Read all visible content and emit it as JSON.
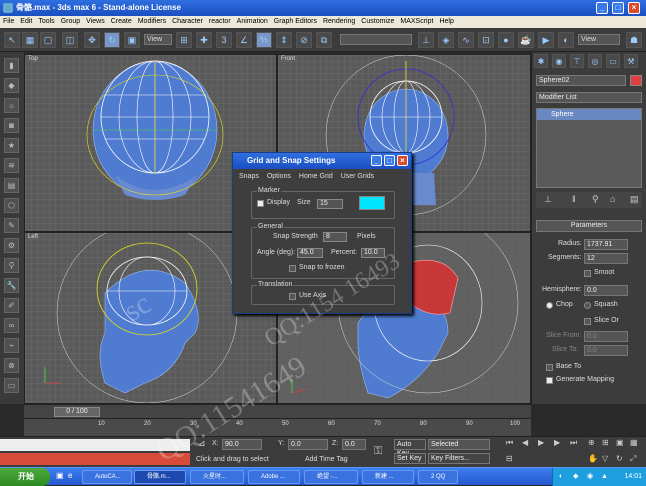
{
  "window": {
    "title": "骨骼.max - 3ds max 6 - Stand-alone License"
  },
  "menu": [
    "File",
    "Edit",
    "Tools",
    "Group",
    "Views",
    "Create",
    "Modifiers",
    "Character",
    "reactor",
    "Animation",
    "Graph Editors",
    "Rendering",
    "Customize",
    "MAXScript",
    "Help"
  ],
  "toolbar": {
    "view_dropdown": "View",
    "view_dropdown2": "View"
  },
  "viewports": {
    "top": "Top",
    "front": "Front",
    "left": "Left",
    "persp": ""
  },
  "dialog": {
    "title": "Grid and Snap Settings",
    "tabs": [
      "Snaps",
      "Options",
      "Home Grid",
      "User Grids"
    ],
    "marker_group": "Marker",
    "display_label": "Display",
    "size_label": "Size",
    "size_value": "15",
    "marker_color": "#00e5ff",
    "general_group": "General",
    "snap_strength_label": "Snap Strength",
    "snap_strength_value": "8",
    "pixels_label": "Pixels",
    "angle_label": "Angle (deg):",
    "angle_value": "45.0",
    "percent_label": "Percent:",
    "percent_value": "10.0",
    "snap_frozen_label": "Snap to frozen",
    "translation_group": "Translation",
    "use_axis_label": "Use Axis"
  },
  "panel": {
    "object_name": "Sphere02",
    "object_color": "#e04040",
    "modifier_list": "Modifier List",
    "stack_item": "Sphere",
    "parameters": "Parameters",
    "radius_label": "Radius:",
    "radius_value": "1737.91",
    "segments_label": "Segments:",
    "segments_value": "12",
    "smooth_label": "Smoot",
    "hemisphere_label": "Hemisphere:",
    "hemisphere_value": "0.0",
    "chop_label": "Chop",
    "squash_label": "Squash",
    "slice_on_label": "Slice Or",
    "slice_from_label": "Slice From:",
    "slice_from_value": "0.0",
    "slice_to_label": "Slice To:",
    "slice_to_value": "0.0",
    "base_to_label": "Base To",
    "gen_mapping_label": "Generate Mapping"
  },
  "trackbar": {
    "frame": "0 / 100",
    "ticks": [
      "10",
      "20",
      "30",
      "40",
      "50",
      "60",
      "70",
      "80",
      "90",
      "100"
    ]
  },
  "status": {
    "x_label": "X:",
    "x_value": "90.0",
    "y_label": "Y:",
    "y_value": "0.0",
    "z_label": "Z:",
    "z_value": "0.0",
    "prompt": "Click and drag to select",
    "add_time_tag": "Add Time Tag",
    "auto_key": "Auto Key",
    "selected": "Selected",
    "set_key": "Set Key",
    "key_filters": "Key Filters..."
  },
  "taskbar": {
    "start": "开始",
    "tasks": [
      "AutoCA...",
      "骨骼.m...",
      "火星时...",
      "Adobe ...",
      "绝望 -...",
      "新建 ...",
      "2 QQ"
    ],
    "clock": "14:01"
  },
  "watermarks": [
    "sc",
    "QQ:11541649",
    "QQ:1154 16493"
  ]
}
